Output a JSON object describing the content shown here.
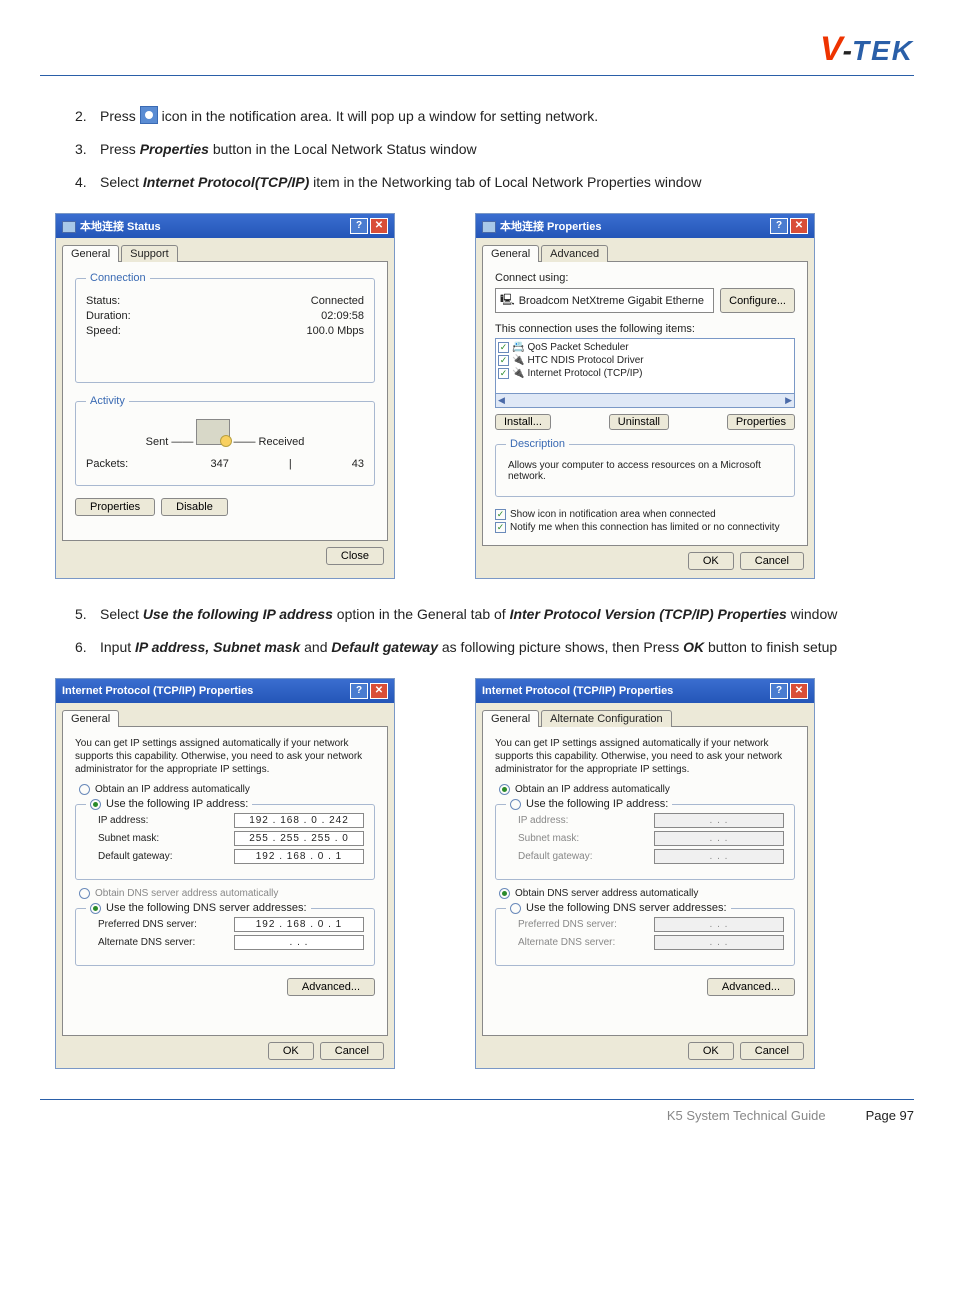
{
  "logo": {
    "v": "V",
    "hyphen": "-",
    "tek": "TEK"
  },
  "steps": {
    "s2": {
      "num": "2.",
      "a": "Press ",
      "b": " icon in the notification area. It will pop up a window for setting network."
    },
    "s3": {
      "num": "3.",
      "a": "Press ",
      "b": "Properties",
      "c": " button in the Local Network Status window"
    },
    "s4": {
      "num": "4.",
      "a": "Select ",
      "b": "Internet Protocol(TCP/IP)",
      "c": " item in the Networking tab of Local Network Properties window"
    },
    "s5": {
      "num": "5.",
      "a": "Select ",
      "b": "Use the following IP address",
      "c": " option in the General tab of ",
      "d": "Inter Protocol Version (TCP/IP) Properties",
      "e": " window"
    },
    "s6": {
      "num": "6.",
      "a": "Input ",
      "b": "IP address, Subnet mask",
      "c": " and ",
      "d": "Default gateway",
      "e": " as following picture shows, then Press ",
      "f": "OK",
      "g": " button to finish setup"
    }
  },
  "win_status": {
    "title": "本地连接 Status",
    "tabs": {
      "general": "General",
      "support": "Support"
    },
    "conn": {
      "legend": "Connection",
      "status_l": "Status:",
      "status_v": "Connected",
      "dur_l": "Duration:",
      "dur_v": "02:09:58",
      "speed_l": "Speed:",
      "speed_v": "100.0 Mbps"
    },
    "act": {
      "legend": "Activity",
      "sent": "Sent",
      "dash": " —— ",
      "recv": "Received",
      "pkts_l": "Packets:",
      "pkts_s": "347",
      "pkts_r": "43"
    },
    "btns": {
      "props": "Properties",
      "disable": "Disable",
      "close": "Close"
    }
  },
  "win_props": {
    "title": "本地连接 Properties",
    "tabs": {
      "general": "General",
      "advanced": "Advanced"
    },
    "connect_using": "Connect using:",
    "adapter": "Broadcom NetXtreme Gigabit Etherne",
    "configure": "Configure...",
    "uses": "This connection uses the following items:",
    "items": [
      "QoS Packet Scheduler",
      "HTC NDIS Protocol Driver",
      "Internet Protocol (TCP/IP)"
    ],
    "install": "Install...",
    "uninstall": "Uninstall",
    "properties": "Properties",
    "desc_legend": "Description",
    "desc": "Allows your computer to access resources on a Microsoft network.",
    "chk1": "Show icon in notification area when connected",
    "chk2": "Notify me when this connection has limited or no connectivity",
    "ok": "OK",
    "cancel": "Cancel"
  },
  "win_tcpip1": {
    "title": "Internet Protocol (TCP/IP) Properties",
    "tabs": {
      "general": "General"
    },
    "help": "You can get IP settings assigned automatically if your network supports this capability. Otherwise, you need to ask your network administrator for the appropriate IP settings.",
    "r1": "Obtain an IP address automatically",
    "r2": "Use the following IP address:",
    "ip_l": "IP address:",
    "ip_v": "192 . 168 .  0  . 242",
    "sm_l": "Subnet mask:",
    "sm_v": "255 . 255 . 255 .  0",
    "gw_l": "Default gateway:",
    "gw_v": "192 . 168 .  0  .  1",
    "r3": "Obtain DNS server address automatically",
    "r4": "Use the following DNS server addresses:",
    "pd_l": "Preferred DNS server:",
    "pd_v": "192 . 168 .  0  .  1",
    "ad_l": "Alternate DNS server:",
    "ad_v": " .       .       .  ",
    "adv": "Advanced...",
    "ok": "OK",
    "cancel": "Cancel"
  },
  "win_tcpip2": {
    "title": "Internet Protocol (TCP/IP) Properties",
    "tabs": {
      "general": "General",
      "alt": "Alternate Configuration"
    },
    "help": "You can get IP settings assigned automatically if your network supports this capability. Otherwise, you need to ask your network administrator for the appropriate IP settings.",
    "r1": "Obtain an IP address automatically",
    "r2": "Use the following IP address:",
    "ip_l": "IP address:",
    "sm_l": "Subnet mask:",
    "gw_l": "Default gateway:",
    "dots": " .       .       .  ",
    "r3": "Obtain DNS server address automatically",
    "r4": "Use the following DNS server addresses:",
    "pd_l": "Preferred DNS server:",
    "ad_l": "Alternate DNS server:",
    "adv": "Advanced...",
    "ok": "OK",
    "cancel": "Cancel"
  },
  "footer": {
    "guide": "K5 System Technical Guide",
    "page": "Page 97"
  }
}
